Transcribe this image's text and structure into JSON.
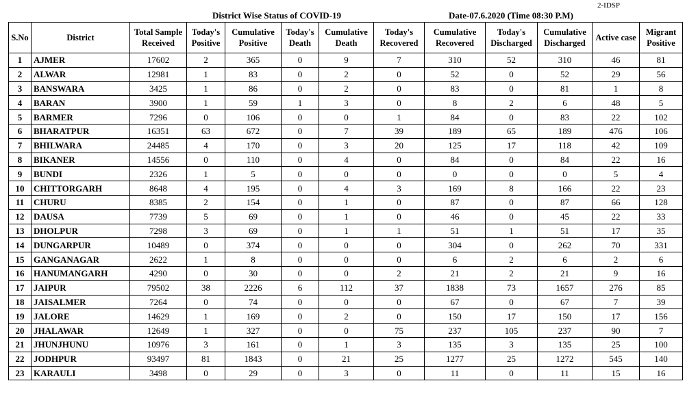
{
  "doc_code": "2-IDSP",
  "title": "District Wise Status of  COVID-19",
  "date": "Date-07.6.2020 (Time 08:30 P.M)",
  "columns": [
    "S.No",
    "District",
    "Total Sample Received",
    "Today's Positive",
    "Cumulative Positive",
    "Today's Death",
    "Cumulative Death",
    "Today's Recovered",
    "Cumulative Recovered",
    "Today's Discharged",
    "Cumulative Discharged",
    "Active  case",
    "Migrant Positive"
  ],
  "rows": [
    [
      "1",
      "AJMER",
      "17602",
      "2",
      "365",
      "0",
      "9",
      "7",
      "310",
      "52",
      "310",
      "46",
      "81"
    ],
    [
      "2",
      "ALWAR",
      "12981",
      "1",
      "83",
      "0",
      "2",
      "0",
      "52",
      "0",
      "52",
      "29",
      "56"
    ],
    [
      "3",
      "BANSWARA",
      "3425",
      "1",
      "86",
      "0",
      "2",
      "0",
      "83",
      "0",
      "81",
      "1",
      "8"
    ],
    [
      "4",
      "BARAN",
      "3900",
      "1",
      "59",
      "1",
      "3",
      "0",
      "8",
      "2",
      "6",
      "48",
      "5"
    ],
    [
      "5",
      "BARMER",
      "7296",
      "0",
      "106",
      "0",
      "0",
      "1",
      "84",
      "0",
      "83",
      "22",
      "102"
    ],
    [
      "6",
      "BHARATPUR",
      "16351",
      "63",
      "672",
      "0",
      "7",
      "39",
      "189",
      "65",
      "189",
      "476",
      "106"
    ],
    [
      "7",
      "BHILWARA",
      "24485",
      "4",
      "170",
      "0",
      "3",
      "20",
      "125",
      "17",
      "118",
      "42",
      "109"
    ],
    [
      "8",
      "BIKANER",
      "14556",
      "0",
      "110",
      "0",
      "4",
      "0",
      "84",
      "0",
      "84",
      "22",
      "16"
    ],
    [
      "9",
      "BUNDI",
      "2326",
      "1",
      "5",
      "0",
      "0",
      "0",
      "0",
      "0",
      "0",
      "5",
      "4"
    ],
    [
      "10",
      "CHITTORGARH",
      "8648",
      "4",
      "195",
      "0",
      "4",
      "3",
      "169",
      "8",
      "166",
      "22",
      "23"
    ],
    [
      "11",
      "CHURU",
      "8385",
      "2",
      "154",
      "0",
      "1",
      "0",
      "87",
      "0",
      "87",
      "66",
      "128"
    ],
    [
      "12",
      "DAUSA",
      "7739",
      "5",
      "69",
      "0",
      "1",
      "0",
      "46",
      "0",
      "45",
      "22",
      "33"
    ],
    [
      "13",
      "DHOLPUR",
      "7298",
      "3",
      "69",
      "0",
      "1",
      "1",
      "51",
      "1",
      "51",
      "17",
      "35"
    ],
    [
      "14",
      "DUNGARPUR",
      "10489",
      "0",
      "374",
      "0",
      "0",
      "0",
      "304",
      "0",
      "262",
      "70",
      "331"
    ],
    [
      "15",
      "GANGANAGAR",
      "2622",
      "1",
      "8",
      "0",
      "0",
      "0",
      "6",
      "2",
      "6",
      "2",
      "6"
    ],
    [
      "16",
      "HANUMANGARH",
      "4290",
      "0",
      "30",
      "0",
      "0",
      "2",
      "21",
      "2",
      "21",
      "9",
      "16"
    ],
    [
      "17",
      "JAIPUR",
      "79502",
      "38",
      "2226",
      "6",
      "112",
      "37",
      "1838",
      "73",
      "1657",
      "276",
      "85"
    ],
    [
      "18",
      "JAISALMER",
      "7264",
      "0",
      "74",
      "0",
      "0",
      "0",
      "67",
      "0",
      "67",
      "7",
      "39"
    ],
    [
      "19",
      "JALORE",
      "14629",
      "1",
      "169",
      "0",
      "2",
      "0",
      "150",
      "17",
      "150",
      "17",
      "156"
    ],
    [
      "20",
      "JHALAWAR",
      "12649",
      "1",
      "327",
      "0",
      "0",
      "75",
      "237",
      "105",
      "237",
      "90",
      "7"
    ],
    [
      "21",
      "JHUNJHUNU",
      "10976",
      "3",
      "161",
      "0",
      "1",
      "3",
      "135",
      "3",
      "135",
      "25",
      "100"
    ],
    [
      "22",
      "JODHPUR",
      "93497",
      "81",
      "1843",
      "0",
      "21",
      "25",
      "1277",
      "25",
      "1272",
      "545",
      "140"
    ],
    [
      "23",
      "KARAULI",
      "3498",
      "0",
      "29",
      "0",
      "3",
      "0",
      "11",
      "0",
      "11",
      "15",
      "16"
    ]
  ]
}
